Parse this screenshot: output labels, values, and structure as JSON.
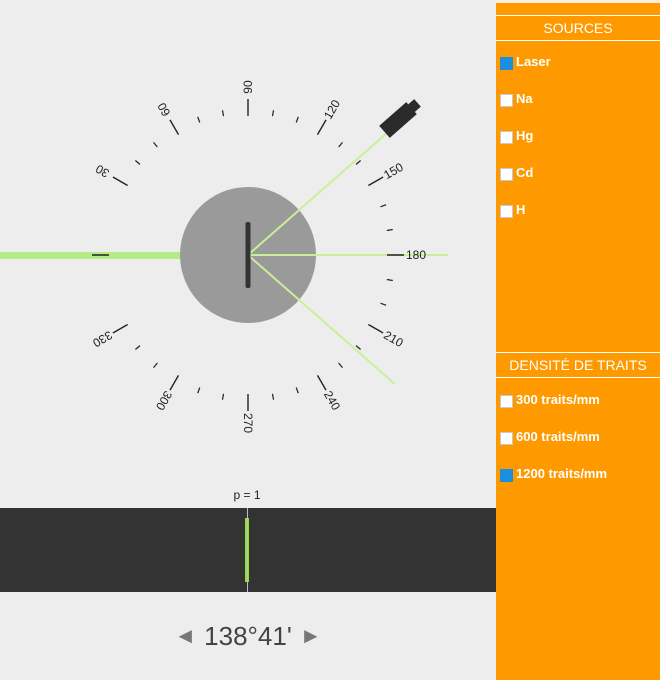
{
  "dial": {
    "tick_labels": [
      "90",
      "120",
      "150",
      "180",
      "210",
      "240",
      "270",
      "300",
      "330",
      "30",
      "60"
    ]
  },
  "spectrum": {
    "order_label": "p = 1",
    "line_color": "#8fe030"
  },
  "angle": {
    "value": "138°41'",
    "left_arrow": "◄",
    "right_arrow": "►"
  },
  "sources": {
    "title": "SOURCES",
    "items": [
      {
        "label": "Laser",
        "checked": true
      },
      {
        "label": "Na",
        "checked": false
      },
      {
        "label": "Hg",
        "checked": false
      },
      {
        "label": "Cd",
        "checked": false
      },
      {
        "label": "H",
        "checked": false
      }
    ]
  },
  "density": {
    "title": "DENSITÉ DE TRAITS",
    "items": [
      {
        "label": "300 traits/mm",
        "checked": false
      },
      {
        "label": "600 traits/mm",
        "checked": false
      },
      {
        "label": "1200 traits/mm",
        "checked": true
      }
    ]
  },
  "colors": {
    "panel": "#ff9900",
    "checked": "#1a8fe0",
    "beam": "#c9ef9a",
    "beam_main": "#b6ea84"
  }
}
